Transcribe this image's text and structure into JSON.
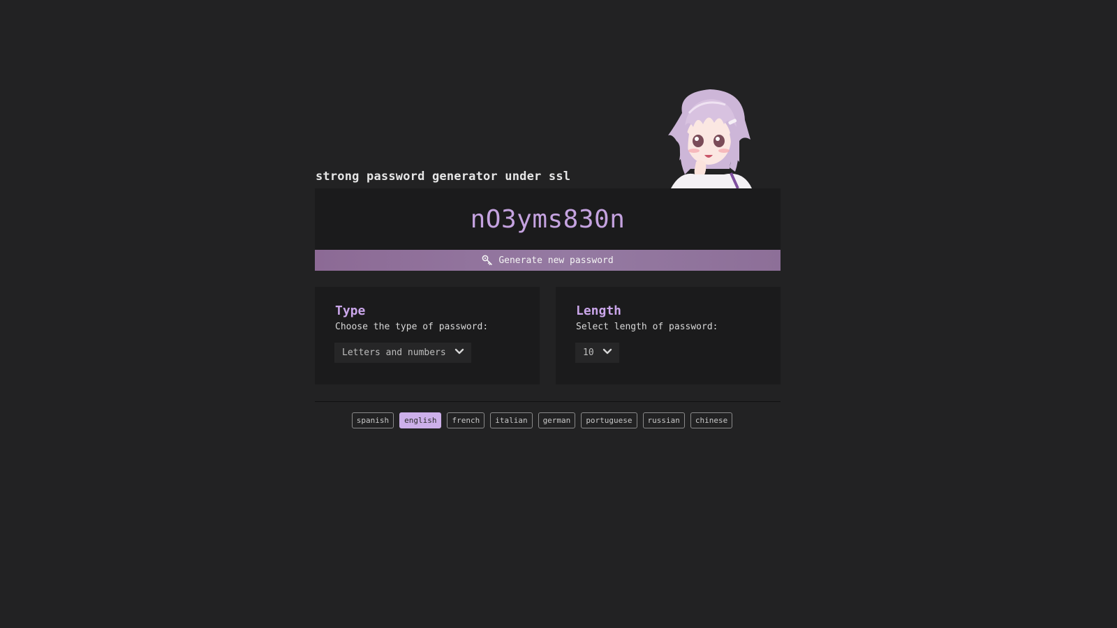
{
  "header": {
    "title": "strong password generator under ssl"
  },
  "password": {
    "value": "nO3yms830n"
  },
  "generate": {
    "label": "Generate new password",
    "icon": "key-icon"
  },
  "type_card": {
    "heading": "Type",
    "description": "Choose the type of password:",
    "selected": "Letters and numbers"
  },
  "length_card": {
    "heading": "Length",
    "description": "Select length of password:",
    "selected": "10"
  },
  "languages": {
    "active": "english",
    "items": [
      "spanish",
      "english",
      "french",
      "italian",
      "german",
      "portuguese",
      "russian",
      "chinese"
    ]
  },
  "colors": {
    "background": "#222223",
    "panel": "#1b1b1c",
    "accent": "#caa6ea",
    "button": "#957aa2"
  }
}
